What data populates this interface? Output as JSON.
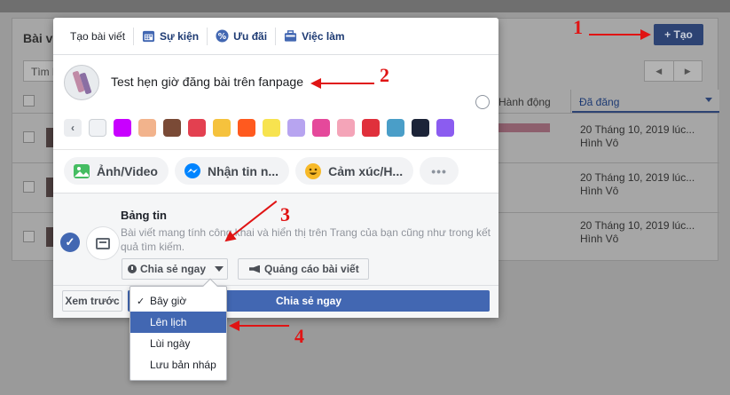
{
  "background": {
    "card_title": "Bài vi",
    "create_button": "+ Tạo",
    "search_placeholder": "Tìm k",
    "columns": {
      "action": "p/Hành động",
      "posted": "Đã đăng"
    },
    "rows": [
      {
        "date": "20 Tháng 10, 2019 lúc...",
        "author": "Hình Vô"
      },
      {
        "date": "20 Tháng 10, 2019 lúc...",
        "author": "Hình Vô"
      },
      {
        "date": "20 Tháng 10, 2019 lúc...",
        "author": "Hình Vô"
      }
    ]
  },
  "modal": {
    "tabs": [
      {
        "label": "Tạo bài viết",
        "icon": "none"
      },
      {
        "label": "Sự kiện",
        "icon": "calendar-icon"
      },
      {
        "label": "Ưu đãi",
        "icon": "percent-icon"
      },
      {
        "label": "Việc làm",
        "icon": "briefcase-icon"
      }
    ],
    "post_text": "Test hẹn giờ đăng bài trên fanpage",
    "swatch_colors": [
      "#f0f2f5",
      "#c800ff",
      "#f2b38c",
      "#7a4a36",
      "#e34050",
      "#f5c23d",
      "#ff5a1f",
      "#f7e34f",
      "#b7a4f0",
      "#e5499b",
      "#f4a4b8",
      "#e0303c",
      "#4a9ec8",
      "#1c2438",
      "#8b5cf0"
    ],
    "actions": [
      {
        "label": "Ảnh/Video",
        "icon": "photo-icon",
        "color": "#45bd62"
      },
      {
        "label": "Nhận tin n...",
        "icon": "messenger-icon",
        "color": "#0084ff"
      },
      {
        "label": "Cảm xúc/H...",
        "icon": "emoji-icon",
        "color": "#f7b928"
      }
    ],
    "more_label": "•••",
    "feed": {
      "title": "Bảng tin",
      "description": "Bài viết mang tính công khai và hiển thị trên Trang của bạn cũng như trong kết quả tìm kiếm."
    },
    "share_dropdown_label": "Chia sẻ ngay",
    "boost_label": "Quảng cáo bài viết",
    "preview_label": "Xem trước",
    "share_now_label": "Chia sẻ ngay"
  },
  "dropdown": {
    "items": [
      {
        "label": "Bây giờ",
        "checked": true,
        "highlighted": false
      },
      {
        "label": "Lên lịch",
        "checked": false,
        "highlighted": true
      },
      {
        "label": "Lùi ngày",
        "checked": false,
        "highlighted": false
      },
      {
        "label": "Lưu bản nháp",
        "checked": false,
        "highlighted": false
      }
    ]
  },
  "annotations": [
    "1",
    "2",
    "3",
    "4"
  ],
  "colors": {
    "accent": "#4267b2",
    "annotation": "#e01414"
  }
}
